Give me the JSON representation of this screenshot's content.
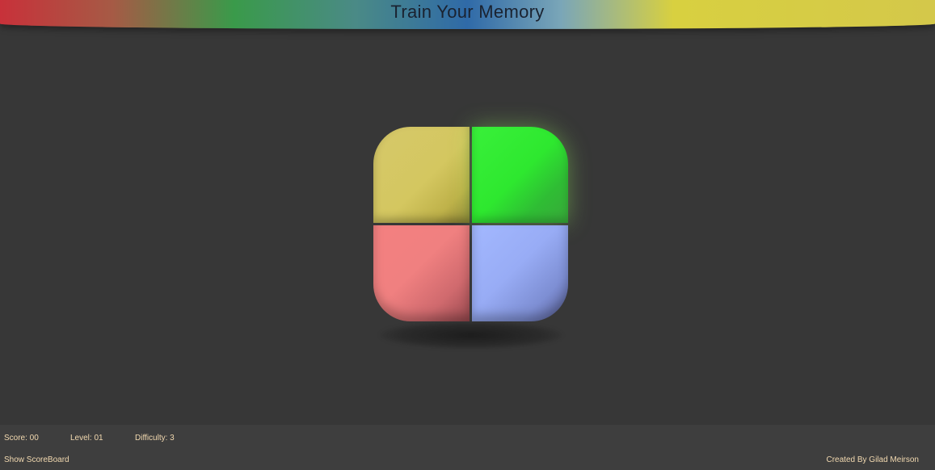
{
  "header": {
    "title": "Train Your Memory"
  },
  "board": {
    "pads": [
      {
        "color_name": "yellow",
        "color": "#d4c760",
        "lit": false
      },
      {
        "color_name": "green",
        "color": "#2ee82f",
        "lit": true
      },
      {
        "color_name": "red",
        "color": "#f08080",
        "lit": false
      },
      {
        "color_name": "blue",
        "color": "#98acf5",
        "lit": false
      }
    ]
  },
  "footer": {
    "score": "Score: 00",
    "level": "Level: 01",
    "difficulty": "Difficulty: 3",
    "show_scoreboard": "Show ScoreBoard",
    "credit": "Created By Gilad Meirson"
  },
  "colors": {
    "background": "#373737",
    "footer_background": "#3e3e3e",
    "footer_text": "#f2d9b0"
  }
}
